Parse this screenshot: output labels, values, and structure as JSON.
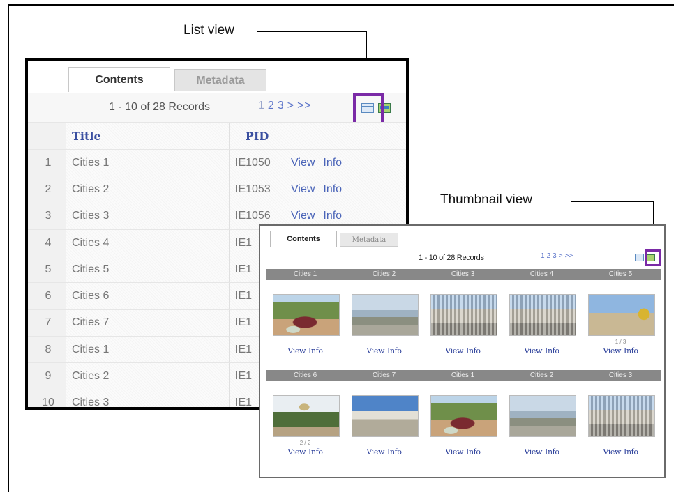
{
  "callouts": {
    "list_view": "List view",
    "thumbnail_view": "Thumbnail view"
  },
  "list_panel": {
    "tabs": [
      {
        "label": "Contents",
        "active": true
      },
      {
        "label": "Metadata",
        "active": false
      }
    ],
    "records": "1 - 10 of 28 Records",
    "pages": [
      "1",
      "2",
      "3",
      ">",
      ">>"
    ],
    "current_page": "1",
    "view_icons": [
      "list-view-icon",
      "thumbnail-view-icon"
    ],
    "highlight_color": "#7a2aa6",
    "columns": {
      "title": "Title",
      "pid": "PID"
    },
    "rows": [
      {
        "n": "1",
        "title": "Cities 1",
        "pid": "IE1050",
        "view": "View",
        "info": "Info"
      },
      {
        "n": "2",
        "title": "Cities 2",
        "pid": "IE1053",
        "view": "View",
        "info": "Info"
      },
      {
        "n": "3",
        "title": "Cities 3",
        "pid": "IE1056",
        "view": "View",
        "info": "Info"
      },
      {
        "n": "4",
        "title": "Cities 4",
        "pid": "IE1"
      },
      {
        "n": "5",
        "title": "Cities 5",
        "pid": "IE1"
      },
      {
        "n": "6",
        "title": "Cities 6",
        "pid": "IE1"
      },
      {
        "n": "7",
        "title": "Cities 7",
        "pid": "IE1"
      },
      {
        "n": "8",
        "title": "Cities 1",
        "pid": "IE1"
      },
      {
        "n": "9",
        "title": "Cities 2",
        "pid": "IE1"
      },
      {
        "n": "10",
        "title": "Cities 3",
        "pid": "IE1"
      }
    ]
  },
  "thumb_panel": {
    "tabs": [
      {
        "label": "Contents",
        "active": true
      },
      {
        "label": "Metadata",
        "active": false
      }
    ],
    "records": "1 - 10 of 28 Records",
    "pages": [
      "1",
      "2",
      "3",
      ">",
      ">>"
    ],
    "link_view": "View",
    "link_info": "Info",
    "groups": [
      {
        "items": [
          {
            "title": "Cities 1",
            "photo": "garden",
            "counter": ""
          },
          {
            "title": "Cities 2",
            "photo": "sea",
            "counter": ""
          },
          {
            "title": "Cities 3",
            "photo": "city",
            "counter": ""
          },
          {
            "title": "Cities 4",
            "photo": "city",
            "counter": ""
          },
          {
            "title": "Cities 5",
            "photo": "dome",
            "counter": "1 / 3"
          }
        ]
      },
      {
        "items": [
          {
            "title": "Cities 6",
            "photo": "shrine",
            "counter": "2 / 2"
          },
          {
            "title": "Cities 7",
            "photo": "bay",
            "counter": ""
          },
          {
            "title": "Cities 1",
            "photo": "garden",
            "counter": ""
          },
          {
            "title": "Cities 2",
            "photo": "sea",
            "counter": ""
          },
          {
            "title": "Cities 3",
            "photo": "city",
            "counter": ""
          }
        ]
      }
    ]
  }
}
